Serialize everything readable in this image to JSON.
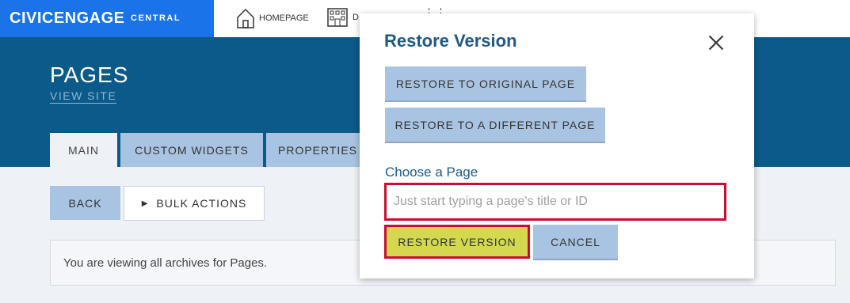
{
  "brand": {
    "name": "CIVICENGAGE",
    "sub": "CENTRAL"
  },
  "nav": {
    "home": "HOMEPAGE",
    "dept": "D"
  },
  "header": {
    "title": "PAGES",
    "view_site": "VIEW SITE"
  },
  "tabs": [
    {
      "label": "MAIN"
    },
    {
      "label": "CUSTOM WIDGETS"
    },
    {
      "label": "PROPERTIES"
    }
  ],
  "actions": {
    "back": "BACK",
    "bulk": "BULK ACTIONS"
  },
  "info": {
    "text": "You are viewing all archives for Pages."
  },
  "modal": {
    "title": "Restore Version",
    "restore_original": "RESTORE TO ORIGINAL PAGE",
    "restore_different": "RESTORE TO A DIFFERENT PAGE",
    "choose_label": "Choose a Page",
    "choose_placeholder": "Just start typing a page's title or ID",
    "restore_version": "RESTORE VERSION",
    "cancel": "CANCEL"
  },
  "colors": {
    "brand_blue": "#1a73e8",
    "header_blue": "#0c5a8a",
    "button_light_blue": "#a9c4e2",
    "restore_yellow": "#d3d84e",
    "highlight_red": "#c8102e"
  }
}
